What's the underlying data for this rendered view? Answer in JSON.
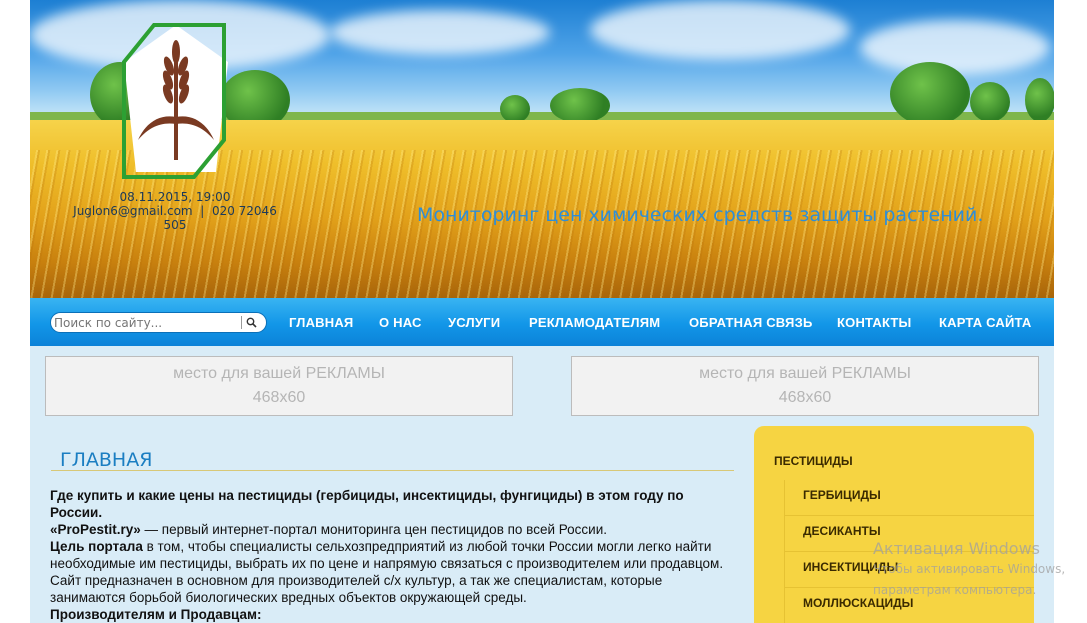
{
  "header": {
    "date": "08.11.2015, 19:00",
    "email": "Juglon6@gmail.com",
    "separator": "|",
    "phone": "020 72046 505",
    "tagline": "Мониторинг цен химических средств защиты растений."
  },
  "search": {
    "placeholder": "Поиск по сайту..."
  },
  "nav": {
    "items": [
      "ГЛАВНАЯ",
      "О НАС",
      "УСЛУГИ",
      "РЕКЛАМОДАТЕЛЯМ",
      "ОБРАТНАЯ СВЯЗЬ",
      "КОНТАКТЫ",
      "КАРТА САЙТА"
    ]
  },
  "ads": [
    {
      "line1": "место для вашей РЕКЛАМЫ",
      "line2": "468x60"
    },
    {
      "line1": "место для вашей РЕКЛАМЫ",
      "line2": "468x60"
    }
  ],
  "content": {
    "title": "ГЛАВНАЯ",
    "intro_bold": "Где купить и какие цены на пестициды (гербициды, инсектициды, фунгициды) в этом году по России.",
    "brand": "«ProPestit.ry»",
    "brand_text": " — первый интернет-портал мониторинга цен пестицидов по всей России.",
    "goal_bold": "Цель портала",
    "goal_text": " в том, чтобы специалисты сельхозпредприятий из любой точки России могли легко найти необходимые им пестициды, выбрать их по цене и напрямую связаться с производителем или продавцом. Сайт предназначен в основном для производителей с/х культур, а так же специалистам, которые занимаются борьбой биологических вредных объектов окружающей среды.",
    "producers_bold": "Производителям и Продавцам:"
  },
  "sidebar": {
    "heading": "ПЕСТИЦИДЫ",
    "items": [
      "ГЕРБИЦИДЫ",
      "ДЕСИКАНТЫ",
      "ИНСЕКТИЦИДЫ",
      "МОЛЛЮСКАЦИДЫ"
    ]
  },
  "watermark": {
    "title": "Активация Windows",
    "line1": "Чтобы активировать Windows,",
    "line2": "параметрам компьютера."
  }
}
